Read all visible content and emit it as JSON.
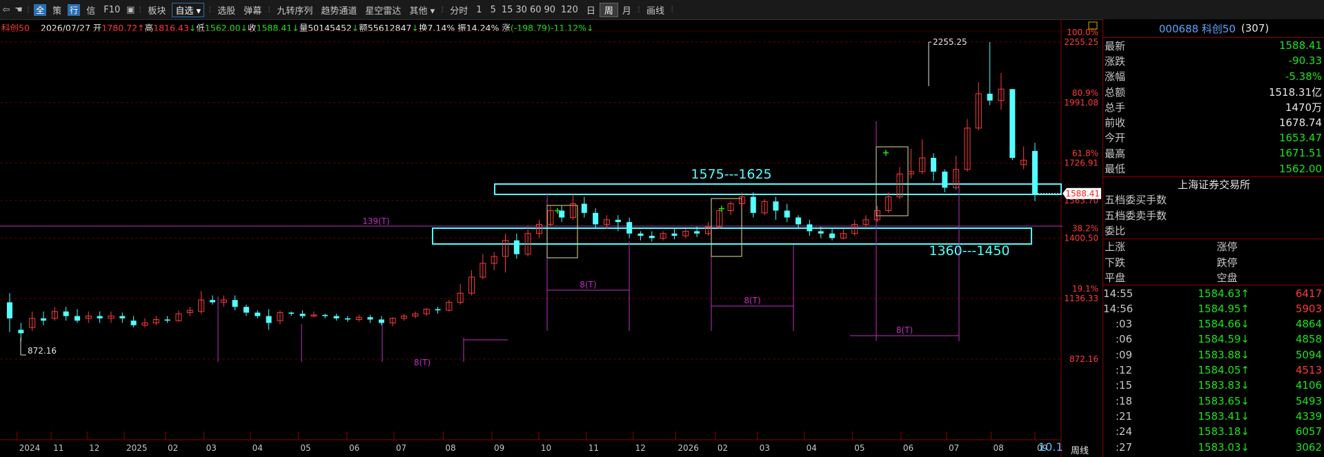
{
  "toolbar": {
    "items": [
      "全",
      "策",
      "行",
      "信",
      "F10",
      "板块",
      "自选",
      "选股",
      "弹幕",
      "九转序列",
      "趋势通道",
      "星空雷达",
      "其他",
      "分时",
      "1",
      "5",
      "15",
      "30",
      "60",
      "90",
      "120",
      "日",
      "周",
      "月",
      "画线"
    ]
  },
  "info": {
    "name": "科创50",
    "date": "2026/07/27",
    "open_label": "开",
    "open": "1780.72",
    "high_label": "高",
    "high": "1816.43",
    "low_label": "低",
    "low": "1562.00",
    "close_label": "收",
    "close": "1588.41",
    "vol_label": "量",
    "vol": "50145452",
    "amt_label": "额",
    "amt": "55612847",
    "turn_label": "换",
    "turn": "7.14%",
    "amp_label": "振",
    "amp": "14.24%",
    "chg_label": "涨",
    "chg": "(-198.79)-11.12%"
  },
  "chart_data": {
    "type": "candlestick",
    "period": "周线",
    "y_ticks": [
      {
        "pct": "100.0%",
        "val": "2255.25"
      },
      {
        "pct": "80.9%",
        "val": "1991.08"
      },
      {
        "pct": "61.8%",
        "val": "1726.91"
      },
      {
        "pct": "",
        "val": "1563.70"
      },
      {
        "pct": "38.2%",
        "val": "1400.50"
      },
      {
        "pct": "19.1%",
        "val": "1136.33"
      },
      {
        "pct": "",
        "val": "872.16"
      }
    ],
    "x_labels": [
      "2024",
      "11",
      "12",
      "2025",
      "02",
      "03",
      "04",
      "05",
      "06",
      "07",
      "08",
      "09",
      "10",
      "11",
      "12",
      "2026",
      "02",
      "03",
      "04",
      "05",
      "06",
      "07",
      "08",
      "09"
    ],
    "current_price_tag": "1588.41",
    "max_label": "2255.25",
    "min_label": "872.16",
    "annotations": {
      "line_139": "139(T)",
      "zone_upper": "1575---1625",
      "zone_lower": "1360---1450",
      "t8_a": "8(T)",
      "t8_b": "8(T)",
      "t8_c": "8(T)",
      "t8_partial": "8(T)",
      "corner": "10.1"
    },
    "candles": [
      [
        1120,
        1050,
        1160,
        990
      ],
      [
        1000,
        985,
        1030,
        950
      ],
      [
        1010,
        1050,
        1080,
        995
      ],
      [
        1050,
        1040,
        1080,
        1020
      ],
      [
        1050,
        1080,
        1100,
        1040
      ],
      [
        1080,
        1060,
        1100,
        1040
      ],
      [
        1060,
        1040,
        1090,
        1030
      ],
      [
        1050,
        1060,
        1080,
        1030
      ],
      [
        1060,
        1050,
        1080,
        1030
      ],
      [
        1050,
        1060,
        1080,
        1030
      ],
      [
        1060,
        1050,
        1075,
        1030
      ],
      [
        1040,
        1020,
        1060,
        1010
      ],
      [
        1020,
        1030,
        1050,
        1010
      ],
      [
        1030,
        1045,
        1060,
        1020
      ],
      [
        1045,
        1040,
        1060,
        1030
      ],
      [
        1040,
        1070,
        1085,
        1035
      ],
      [
        1075,
        1085,
        1100,
        1060
      ],
      [
        1080,
        1130,
        1170,
        1070
      ],
      [
        1130,
        1120,
        1150,
        1110
      ],
      [
        1120,
        1130,
        1150,
        1100
      ],
      [
        1130,
        1100,
        1150,
        1085
      ],
      [
        1100,
        1075,
        1110,
        1060
      ],
      [
        1075,
        1060,
        1085,
        1050
      ],
      [
        1060,
        1030,
        1090,
        1000
      ],
      [
        1040,
        1075,
        1085,
        1025
      ],
      [
        1075,
        1070,
        1080,
        1060
      ],
      [
        1070,
        1060,
        1085,
        1050
      ],
      [
        1060,
        1065,
        1080,
        1055
      ],
      [
        1065,
        1060,
        1070,
        1050
      ],
      [
        1060,
        1050,
        1070,
        1040
      ],
      [
        1050,
        1045,
        1060,
        1035
      ],
      [
        1045,
        1055,
        1065,
        1035
      ],
      [
        1055,
        1045,
        1065,
        1030
      ],
      [
        1045,
        1030,
        1060,
        1020
      ],
      [
        1030,
        1050,
        1055,
        1015
      ],
      [
        1050,
        1060,
        1070,
        1040
      ],
      [
        1060,
        1070,
        1080,
        1050
      ],
      [
        1070,
        1090,
        1095,
        1060
      ],
      [
        1090,
        1085,
        1100,
        1070
      ],
      [
        1085,
        1120,
        1130,
        1080
      ],
      [
        1120,
        1160,
        1200,
        1110
      ],
      [
        1160,
        1230,
        1260,
        1150
      ],
      [
        1230,
        1290,
        1330,
        1220
      ],
      [
        1290,
        1320,
        1340,
        1260
      ],
      [
        1320,
        1390,
        1420,
        1250
      ],
      [
        1390,
        1330,
        1420,
        1310
      ],
      [
        1330,
        1420,
        1450,
        1320
      ],
      [
        1420,
        1460,
        1480,
        1400
      ],
      [
        1460,
        1520,
        1540,
        1450
      ],
      [
        1520,
        1490,
        1540,
        1470
      ],
      [
        1490,
        1550,
        1590,
        1480
      ],
      [
        1550,
        1510,
        1580,
        1490
      ],
      [
        1510,
        1460,
        1530,
        1440
      ],
      [
        1460,
        1480,
        1500,
        1440
      ],
      [
        1480,
        1470,
        1500,
        1430
      ],
      [
        1470,
        1420,
        1490,
        1400
      ],
      [
        1420,
        1410,
        1430,
        1390
      ],
      [
        1410,
        1400,
        1430,
        1385
      ],
      [
        1400,
        1420,
        1430,
        1390
      ],
      [
        1420,
        1410,
        1440,
        1395
      ],
      [
        1410,
        1430,
        1440,
        1400
      ],
      [
        1430,
        1420,
        1450,
        1405
      ],
      [
        1420,
        1450,
        1470,
        1410
      ],
      [
        1450,
        1520,
        1530,
        1440
      ],
      [
        1520,
        1550,
        1560,
        1500
      ],
      [
        1550,
        1580,
        1600,
        1540
      ],
      [
        1580,
        1510,
        1600,
        1490
      ],
      [
        1510,
        1560,
        1570,
        1500
      ],
      [
        1560,
        1520,
        1580,
        1480
      ],
      [
        1520,
        1490,
        1550,
        1470
      ],
      [
        1490,
        1460,
        1500,
        1440
      ],
      [
        1460,
        1430,
        1480,
        1410
      ],
      [
        1430,
        1420,
        1450,
        1400
      ],
      [
        1420,
        1400,
        1440,
        1390
      ],
      [
        1400,
        1420,
        1440,
        1395
      ],
      [
        1420,
        1460,
        1480,
        1410
      ],
      [
        1460,
        1480,
        1500,
        1450
      ],
      [
        1480,
        1520,
        1540,
        1470
      ],
      [
        1520,
        1580,
        1600,
        1510
      ],
      [
        1580,
        1680,
        1710,
        1570
      ],
      [
        1680,
        1690,
        1790,
        1660
      ],
      [
        1690,
        1750,
        1830,
        1680
      ],
      [
        1750,
        1690,
        1770,
        1650
      ],
      [
        1690,
        1620,
        1700,
        1600
      ],
      [
        1620,
        1700,
        1760,
        1610
      ],
      [
        1700,
        1880,
        1920,
        1690
      ],
      [
        1880,
        2030,
        2080,
        1870
      ],
      [
        2030,
        2000,
        2255,
        1980
      ],
      [
        2000,
        2050,
        2120,
        1960
      ],
      [
        2050,
        1750,
        2030,
        1740
      ],
      [
        1720,
        1740,
        1800,
        1700
      ],
      [
        1780,
        1588,
        1816,
        1562
      ]
    ]
  },
  "panel": {
    "code": "000688 科创50",
    "count": "(307)",
    "quotes": [
      {
        "label": "最新",
        "value": "1588.41",
        "color": "green"
      },
      {
        "label": "涨跌",
        "value": "-90.33",
        "color": "green"
      },
      {
        "label": "涨幅",
        "value": "-5.38%",
        "color": "green"
      },
      {
        "label": "总额",
        "value": "1518.31亿",
        "color": "white"
      },
      {
        "label": "总手",
        "value": "1470万",
        "color": "white"
      },
      {
        "label": "前收",
        "value": "1678.74",
        "color": "white"
      },
      {
        "label": "今开",
        "value": "1653.47",
        "color": "green"
      },
      {
        "label": "最高",
        "value": "1671.51",
        "color": "green"
      },
      {
        "label": "最低",
        "value": "1562.00",
        "color": "green"
      }
    ],
    "exchange": "上海证券交易所",
    "depth": [
      "五档委买手数",
      "五档委卖手数",
      "委比"
    ],
    "breadth": [
      [
        "上涨",
        "涨停"
      ],
      [
        "下跌",
        "跌停"
      ],
      [
        "平盘",
        "空盘"
      ]
    ],
    "ticks": [
      {
        "t": "14:55",
        "p": "1584.63↑",
        "v": "6417",
        "c": "red"
      },
      {
        "t": "14:56",
        "p": "1584.95↑",
        "v": "5903",
        "c": "red"
      },
      {
        "t": ":03",
        "p": "1584.66↓",
        "v": "4864",
        "c": "green"
      },
      {
        "t": ":06",
        "p": "1584.59↓",
        "v": "4858",
        "c": "green"
      },
      {
        "t": ":09",
        "p": "1583.88↓",
        "v": "5094",
        "c": "green"
      },
      {
        "t": ":12",
        "p": "1584.05↑",
        "v": "4513",
        "c": "red"
      },
      {
        "t": ":15",
        "p": "1583.83↓",
        "v": "4106",
        "c": "green"
      },
      {
        "t": ":18",
        "p": "1583.65↓",
        "v": "5493",
        "c": "green"
      },
      {
        "t": ":21",
        "p": "1583.41↓",
        "v": "4339",
        "c": "green"
      },
      {
        "t": ":24",
        "p": "1583.18↓",
        "v": "6057",
        "c": "green"
      },
      {
        "t": ":27",
        "p": "1583.03↓",
        "v": "3062",
        "c": "green"
      }
    ]
  }
}
